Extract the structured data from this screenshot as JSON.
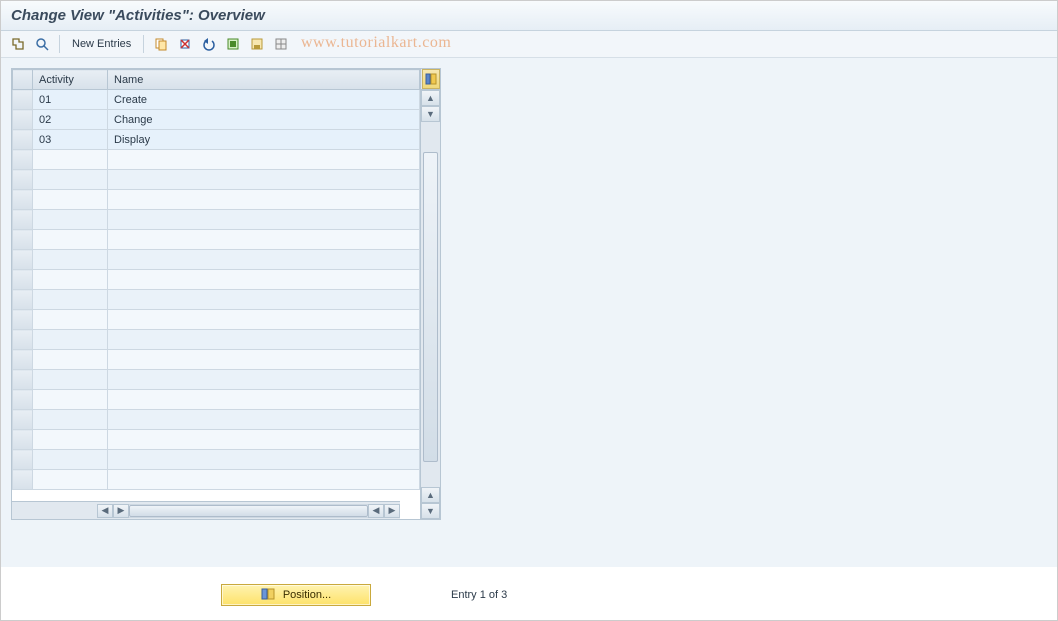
{
  "header": {
    "title": "Change View \"Activities\": Overview"
  },
  "toolbar": {
    "new_entries": "New Entries",
    "icons": {
      "toggle": "toggle-icon",
      "find": "find-icon",
      "copy": "copy-icon",
      "delete": "delete-icon",
      "undo": "undo-icon",
      "select_all": "select-all-icon",
      "deselect_all": "deselect-all-icon",
      "config": "config-icon"
    }
  },
  "watermark": "www.tutorialkart.com",
  "grid": {
    "columns": {
      "activity": "Activity",
      "name": "Name"
    },
    "rows": [
      {
        "activity": "01",
        "name": "Create"
      },
      {
        "activity": "02",
        "name": "Change"
      },
      {
        "activity": "03",
        "name": "Display"
      }
    ],
    "empty_rows": 17
  },
  "footer": {
    "position_label": "Position...",
    "entry_text": "Entry 1 of 3"
  }
}
